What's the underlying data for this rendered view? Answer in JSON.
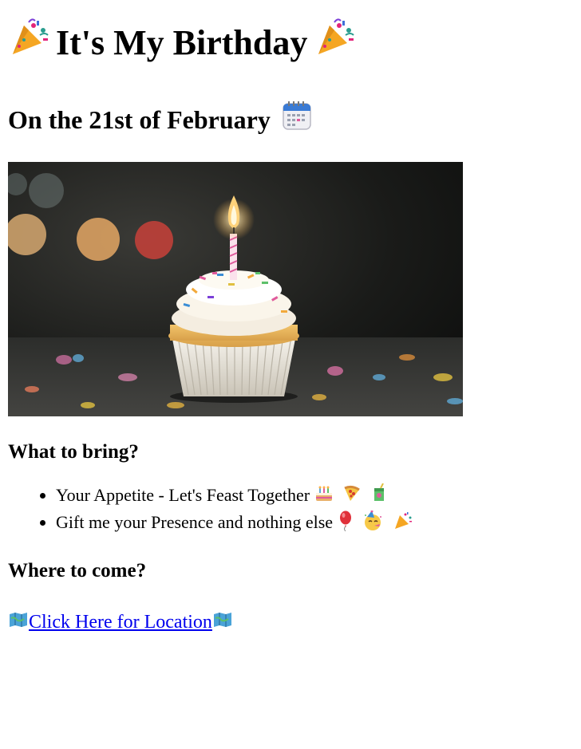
{
  "header": {
    "title": "It's My Birthday",
    "title_left_icon": "party-popper-icon",
    "title_right_icon": "party-popper-icon"
  },
  "date_heading": {
    "text": "On the 21st of February",
    "icon": "calendar-icon"
  },
  "photo": {
    "subject": "cupcake-with-candle"
  },
  "bring_section": {
    "title": "What to bring?",
    "items": [
      {
        "text": "Your Appetite - Let's Feast Together",
        "icons": [
          "cake-icon",
          "pizza-icon",
          "juice-box-icon"
        ]
      },
      {
        "text": "Gift me your Presence and nothing else",
        "icons": [
          "balloon-icon",
          "party-face-icon",
          "party-popper-icon"
        ]
      }
    ]
  },
  "come_section": {
    "title": "Where to come?",
    "link_text": "Click Here for Location",
    "link_icon": "map-icon"
  },
  "colors": {
    "link": "#0000ee",
    "text": "#000000",
    "background": "#ffffff"
  }
}
